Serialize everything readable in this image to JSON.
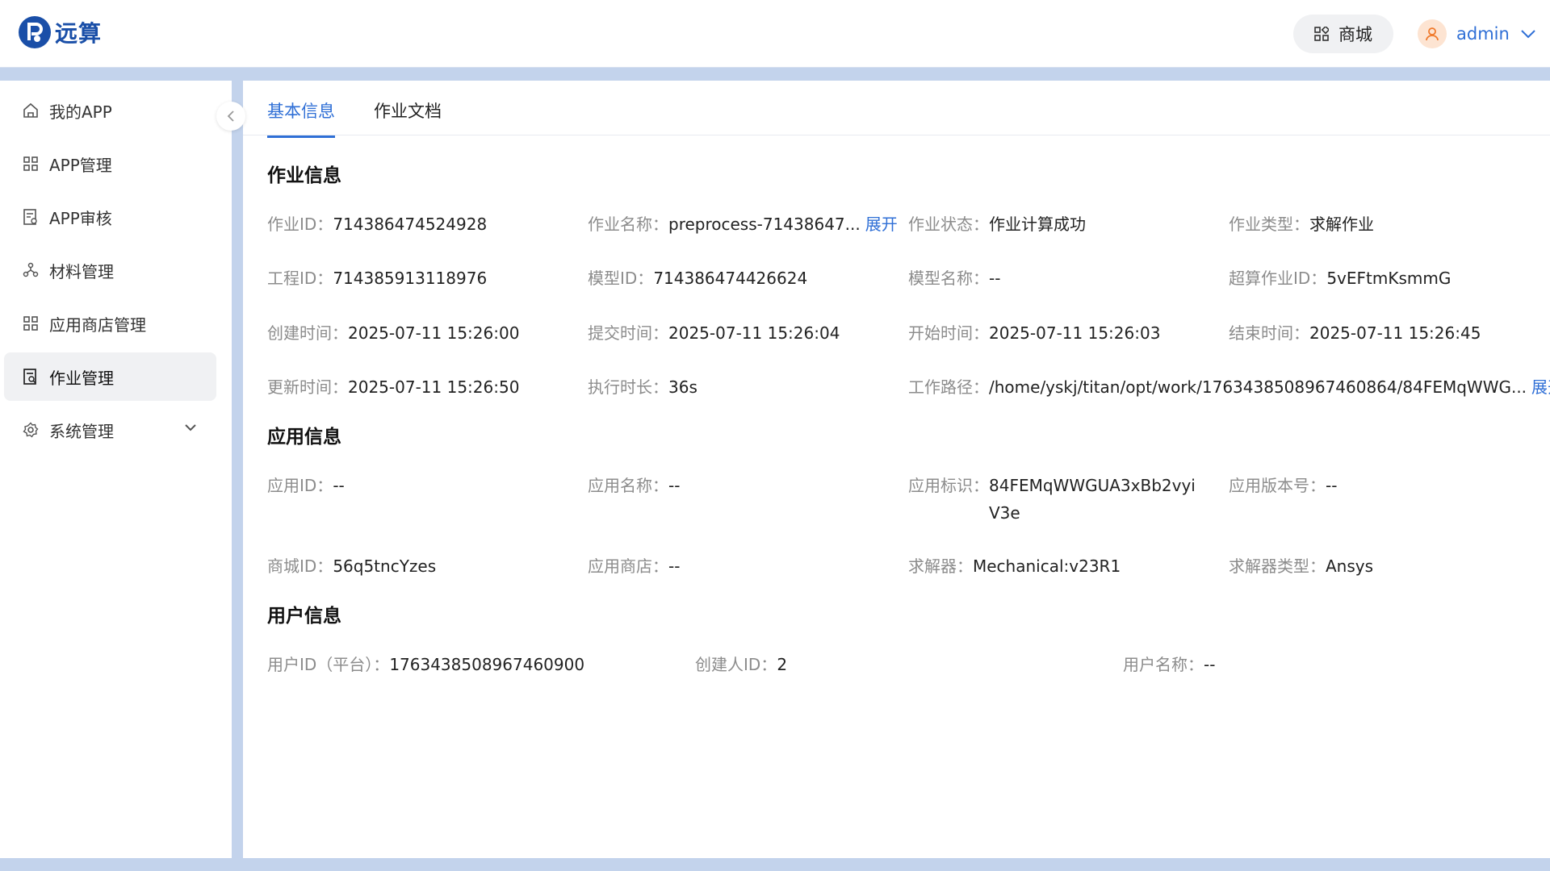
{
  "header": {
    "logo_text": "远算",
    "shop_label": "商城",
    "user_name": "admin",
    "brand_color": "#2f6fd6"
  },
  "sidebar": {
    "items": [
      {
        "label": "我的APP",
        "icon": "home-icon"
      },
      {
        "label": "APP管理",
        "icon": "grid-icon"
      },
      {
        "label": "APP审核",
        "icon": "audit-doc-icon"
      },
      {
        "label": "材料管理",
        "icon": "molecule-icon"
      },
      {
        "label": "应用商店管理",
        "icon": "grid-icon"
      },
      {
        "label": "作业管理",
        "icon": "job-doc-icon",
        "active": true
      },
      {
        "label": "系统管理",
        "icon": "gear-icon",
        "expandable": true
      }
    ]
  },
  "tabs": [
    {
      "label": "基本信息",
      "active": true
    },
    {
      "label": "作业文档",
      "active": false
    }
  ],
  "sections": {
    "job": {
      "title": "作业信息",
      "job_id": {
        "label": "作业ID：",
        "value": "714386474524928"
      },
      "job_name": {
        "label": "作业名称：",
        "value": "preprocess-71438647...",
        "link": "展开"
      },
      "job_status": {
        "label": "作业状态：",
        "value": "作业计算成功"
      },
      "job_type": {
        "label": "作业类型：",
        "value": "求解作业"
      },
      "project_id": {
        "label": "工程ID：",
        "value": "714385913118976"
      },
      "model_id": {
        "label": "模型ID：",
        "value": "714386474426624"
      },
      "model_name": {
        "label": "模型名称：",
        "value": "--"
      },
      "hpc_job_id": {
        "label": "超算作业ID：",
        "value": "5vEFtmKsmmG"
      },
      "created_time": {
        "label": "创建时间：",
        "value": "2025-07-11 15:26:00"
      },
      "submit_time": {
        "label": "提交时间：",
        "value": "2025-07-11 15:26:04"
      },
      "start_time": {
        "label": "开始时间：",
        "value": "2025-07-11 15:26:03"
      },
      "end_time": {
        "label": "结束时间：",
        "value": "2025-07-11 15:26:45"
      },
      "update_time": {
        "label": "更新时间：",
        "value": "2025-07-11 15:26:50"
      },
      "duration": {
        "label": "执行时长：",
        "value": "36s"
      },
      "work_path": {
        "label": "工作路径：",
        "value": "/home/yskj/titan/opt/work/1763438508967460864/84FEMqWWG...",
        "link": "展开"
      }
    },
    "app": {
      "title": "应用信息",
      "app_id": {
        "label": "应用ID：",
        "value": "--"
      },
      "app_name": {
        "label": "应用名称：",
        "value": "--"
      },
      "app_key": {
        "label": "应用标识：",
        "value": "84FEMqWWGUA3xBb2vyiV3e"
      },
      "app_version": {
        "label": "应用版本号：",
        "value": "--"
      },
      "mall_id": {
        "label": "商城ID：",
        "value": "56q5tncYzes"
      },
      "app_store": {
        "label": "应用商店：",
        "value": "--"
      },
      "solver": {
        "label": "求解器：",
        "value": "Mechanical:v23R1"
      },
      "solver_type": {
        "label": "求解器类型：",
        "value": "Ansys"
      }
    },
    "user": {
      "title": "用户信息",
      "platform_user_id": {
        "label": "用户ID（平台）：",
        "value": "1763438508967460900"
      },
      "creator_id": {
        "label": "创建人ID：",
        "value": "2"
      },
      "user_name": {
        "label": "用户名称：",
        "value": "--"
      }
    }
  }
}
